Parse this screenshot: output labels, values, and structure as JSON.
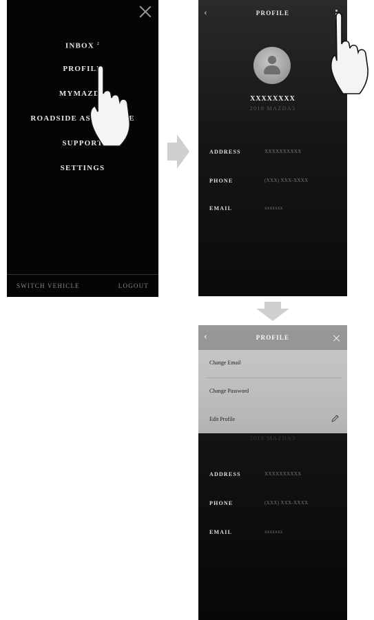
{
  "menu_screen": {
    "items": [
      {
        "label": "INBOX",
        "badge": "2"
      },
      {
        "label": "PROFILE"
      },
      {
        "label": "MYMAZDA"
      },
      {
        "label": "ROADSIDE ASSISTANCE"
      },
      {
        "label": "SUPPORT"
      },
      {
        "label": "SETTINGS"
      }
    ],
    "footer_left": "SWITCH VEHICLE",
    "footer_right": "LOGOUT"
  },
  "profile_screen": {
    "title": "PROFILE",
    "name": "XXXXXXXX",
    "vehicle": "2018 MAZDA3",
    "fields": [
      {
        "label": "ADDRESS",
        "value": "XXXXXXXXXX"
      },
      {
        "label": "PHONE",
        "value": "(XXX) XXX-XXXX"
      },
      {
        "label": "EMAIL",
        "value": "xxxxxxx"
      }
    ]
  },
  "options_screen": {
    "title": "PROFILE",
    "menu_items": [
      "Change Email",
      "Change Password",
      "Edit Profile"
    ],
    "partial_vehicle": "2018 MAZDA3",
    "fields": [
      {
        "label": "ADDRESS",
        "value": "XXXXXXXXXX"
      },
      {
        "label": "PHONE",
        "value": "(XXX) XXX-XXXX"
      },
      {
        "label": "EMAIL",
        "value": "xxxxxxx"
      }
    ]
  },
  "colors": {
    "background": "#ffffff",
    "screen_background": "#050505",
    "dropdown_background": "#c4c4c4",
    "arrow": "#c8c8c8"
  },
  "icons": [
    "close-icon",
    "back-chevron-icon",
    "more-vertical-icon",
    "avatar-icon",
    "pencil-icon",
    "tap-hand-icon",
    "arrow-right-icon",
    "arrow-down-icon"
  ]
}
